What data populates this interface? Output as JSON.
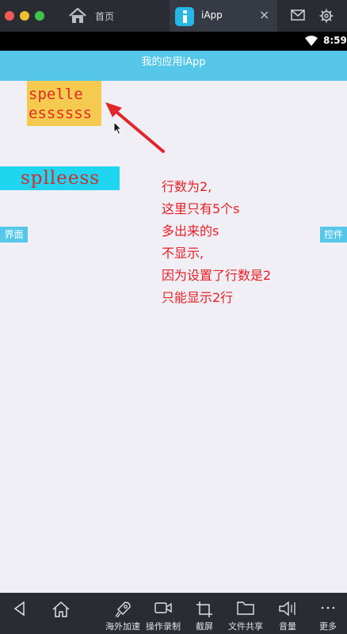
{
  "chrome": {
    "home_tab": {
      "label": "首页",
      "icon": "home-icon"
    },
    "active_tab": {
      "label": "iApp",
      "icon": "iapp-icon",
      "close": "×"
    },
    "right_icons": [
      "mail-icon",
      "gear-icon"
    ]
  },
  "status_bar": {
    "time": "8:59",
    "icon": "wifi-icon"
  },
  "app": {
    "title": "我的应用iApp",
    "textview1": {
      "lines": [
        "spelle",
        "essssss"
      ]
    },
    "textview2": {
      "text": "splleess"
    },
    "left_label": "界面",
    "right_label": "控件"
  },
  "annotation": {
    "lines": [
      "行数为2,",
      "这里只有5个s",
      "多出来的s",
      "不显示,",
      "因为设置了行数是2",
      "只能显示2行"
    ]
  },
  "toolbar": {
    "items": [
      {
        "label": "",
        "icon": "back-icon"
      },
      {
        "label": "",
        "icon": "home-icon"
      },
      {
        "label": "海外加速",
        "icon": "rocket-icon"
      },
      {
        "label": "操作录制",
        "icon": "video-icon"
      },
      {
        "label": "截屏",
        "icon": "crop-icon"
      },
      {
        "label": "文件共享",
        "icon": "folder-icon"
      },
      {
        "label": "音量",
        "icon": "speaker-icon"
      },
      {
        "label": "更多",
        "icon": "more-icon"
      }
    ]
  },
  "colors": {
    "chrome_bg": "#2a2c33",
    "titlebar": "#56c7e9",
    "textview1_bg": "#f5cb4f",
    "textview2_bg": "#1fd5f0",
    "annotation_red": "#e52025"
  }
}
